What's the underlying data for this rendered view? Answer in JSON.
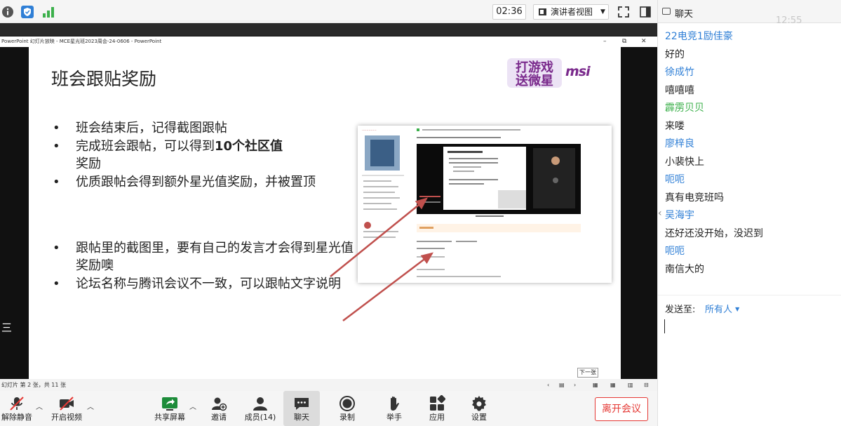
{
  "topbar": {
    "timer": "02:36",
    "presenter_view": "演讲者视图"
  },
  "ppt": {
    "window_title": "PowerPoint 幻灯片放映 - MCE星光班2023周会-24-0606 - PowerPoint",
    "status": "幻灯片 第 2 张，共 11 张",
    "tooltip": "下一张",
    "left_edge_text": "三"
  },
  "slide": {
    "title": "班会跟贴奖励",
    "logo_text": "打游戏\n送微星",
    "logo_brand": "msi",
    "bullets_top": [
      {
        "pre": "班会结束后，记得截图跟帖",
        "bold": "",
        "post": ""
      },
      {
        "pre": "完成班会跟帖，可以得到",
        "bold": "10个社区值",
        "post": "奖励"
      },
      {
        "pre": "优质跟帖会得到额外星光值奖励，并被置顶",
        "bold": "",
        "post": ""
      }
    ],
    "bullets_bottom": [
      {
        "pre": "跟帖里的截图里，要有自己的发言才会得到星光值奖励噢",
        "bold": "",
        "post": ""
      },
      {
        "pre": "论坛名称与腾讯会议不一致，可以跟帖文字说明",
        "bold": "",
        "post": ""
      }
    ]
  },
  "toolbar": {
    "mute": "解除静音",
    "video": "开启视频",
    "share": "共享屏幕",
    "invite": "邀请",
    "members": "成员(14)",
    "chat": "聊天",
    "record": "录制",
    "raise_hand": "举手",
    "apps": "应用",
    "settings": "设置",
    "leave": "离开会议"
  },
  "chat": {
    "title": "聊天",
    "faded_time": "12:55",
    "messages": [
      {
        "text": "22电竞1励佳豪",
        "kind": "name"
      },
      {
        "text": "好的",
        "kind": "text"
      },
      {
        "text": "徐成竹",
        "kind": "name"
      },
      {
        "text": "嘻嘻嘻",
        "kind": "text"
      },
      {
        "text": "霹雳贝贝",
        "kind": "name-green"
      },
      {
        "text": "来喽",
        "kind": "text"
      },
      {
        "text": "廖梓良",
        "kind": "name"
      },
      {
        "text": "小裴快上",
        "kind": "text"
      },
      {
        "text": "呃呃",
        "kind": "name"
      },
      {
        "text": "真有电竞班吗",
        "kind": "text"
      },
      {
        "text": "吴海宇",
        "kind": "name"
      },
      {
        "text": "还好还没开始，没迟到",
        "kind": "text"
      },
      {
        "text": "呃呃",
        "kind": "name"
      },
      {
        "text": "南信大的",
        "kind": "text"
      }
    ],
    "send_to_label": "发送至:",
    "send_to_value": "所有人"
  },
  "colors": {
    "accent_blue": "#2f7fd6",
    "name_green": "#3cb04b",
    "leave_red": "#e53935",
    "arrow_red": "#c0504d",
    "logo_purple": "#7a2a8c"
  }
}
